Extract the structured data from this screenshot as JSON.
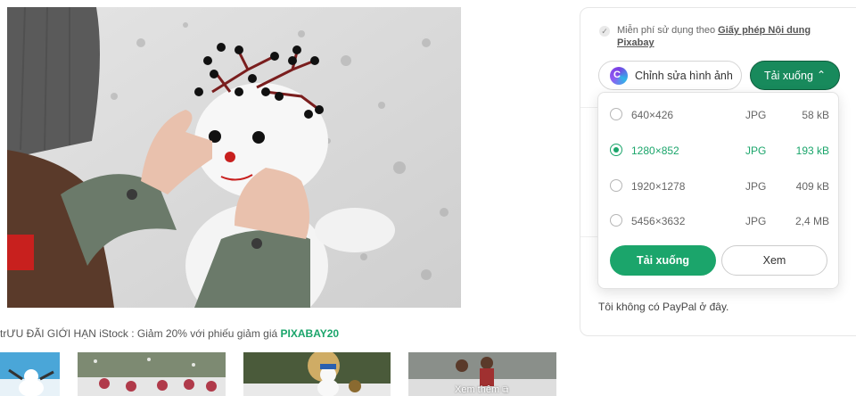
{
  "promo": {
    "prefix": "trƯU ĐÃI GIỚI HẠN iStock  : Giảm 20% với phiếu giảm giá ",
    "code": "PIXABAY20"
  },
  "thumbnails": {
    "see_more": "Xem thêm",
    "see_more_icon": "external-link-icon"
  },
  "sidebar": {
    "license_prefix": "Miễn phí sử dụng theo ",
    "license_link": "Giấy phép Nội dung Pixabay",
    "edit_button": "Chỉnh sửa hình ảnh",
    "download_button": "Tải xuống",
    "tail_text": "Tôi không có PayPal ở đây."
  },
  "download_options": [
    {
      "resolution": "640×426",
      "format": "JPG",
      "size": "58 kB",
      "selected": false
    },
    {
      "resolution": "1280×852",
      "format": "JPG",
      "size": "193 kB",
      "selected": true
    },
    {
      "resolution": "1920×1278",
      "format": "JPG",
      "size": "409 kB",
      "selected": false
    },
    {
      "resolution": "5456×3632",
      "format": "JPG",
      "size": "2,4 MB",
      "selected": false
    }
  ],
  "popup": {
    "download_button": "Tải xuống",
    "view_button": "Xem"
  },
  "colors": {
    "accent_green": "#1ba56b",
    "dark_green": "#188a5c"
  }
}
